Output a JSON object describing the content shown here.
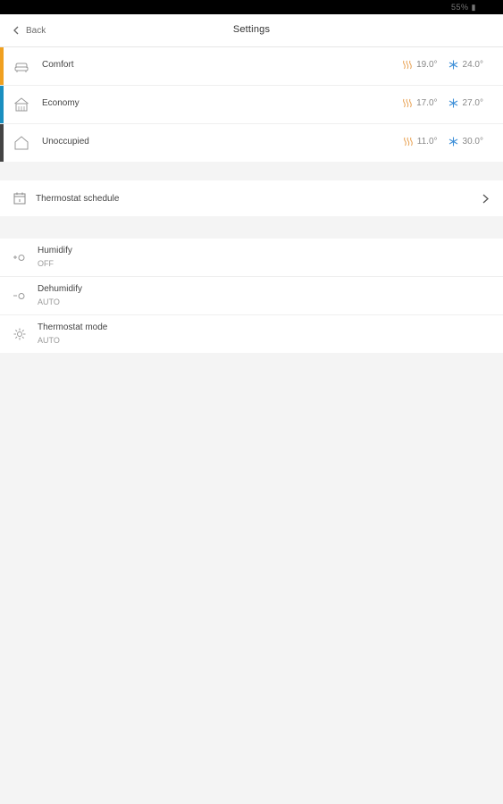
{
  "status_bar": {
    "text": "55% ▮"
  },
  "header": {
    "back_label": "Back",
    "title": "Settings"
  },
  "presets": [
    {
      "label": "Comfort",
      "accent": "#f0a020",
      "icon": "sofa-icon",
      "heat": "19.0°",
      "cool": "24.0°"
    },
    {
      "label": "Economy",
      "accent": "#1a8fc0",
      "icon": "building-icon",
      "heat": "17.0°",
      "cool": "27.0°"
    },
    {
      "label": "Unoccupied",
      "accent": "#444444",
      "icon": "house-icon",
      "heat": "11.0°",
      "cool": "30.0°"
    }
  ],
  "colors": {
    "heat": "#e8a050",
    "cool": "#3d8fd8"
  },
  "schedule": {
    "label": "Thermostat schedule"
  },
  "modes": [
    {
      "label": "Humidify",
      "value": "OFF",
      "icon": "humidify-icon"
    },
    {
      "label": "Dehumidify",
      "value": "AUTO",
      "icon": "dehumidify-icon"
    },
    {
      "label": "Thermostat mode",
      "value": "AUTO",
      "icon": "thermostat-mode-icon"
    }
  ]
}
